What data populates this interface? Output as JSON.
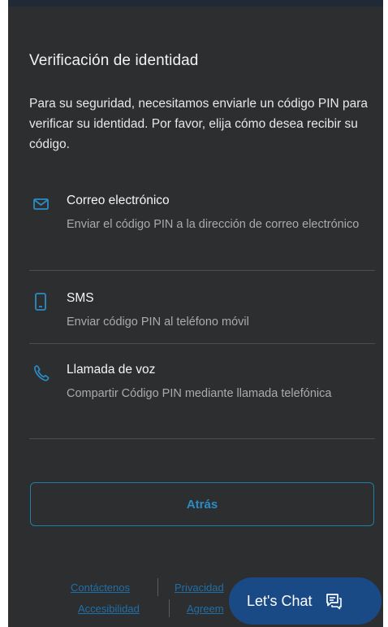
{
  "dialog": {
    "title": "Verificación de identidad",
    "intro": "Para su seguridad, necesitamos enviarle un código PIN para verificar su identidad. Por favor, elija cómo desea recibir su código."
  },
  "options": [
    {
      "icon": "envelope-icon",
      "title": "Correo electrónico",
      "description": "Enviar el código PIN a la dirección de correo electrónico"
    },
    {
      "icon": "mobile-phone-icon",
      "title": "SMS",
      "description": "Enviar código PIN al teléfono móvil"
    },
    {
      "icon": "phone-handset-icon",
      "title": "Llamada de voz",
      "description": "Compartir Código PIN mediante llamada telefónica"
    }
  ],
  "actions": {
    "back_label": "Atrás"
  },
  "footer": {
    "links": [
      "Contáctenos",
      "Privacidad",
      "Accesibilidad",
      "Agreem"
    ]
  },
  "chat": {
    "label": "Let's Chat",
    "icon": "chat-bubble-icon"
  },
  "colors": {
    "panel_bg": "#2d2e30",
    "accent_blue": "#2b8cc4",
    "chat_button_bg": "#1a4a86",
    "muted_text": "#a9abae"
  }
}
